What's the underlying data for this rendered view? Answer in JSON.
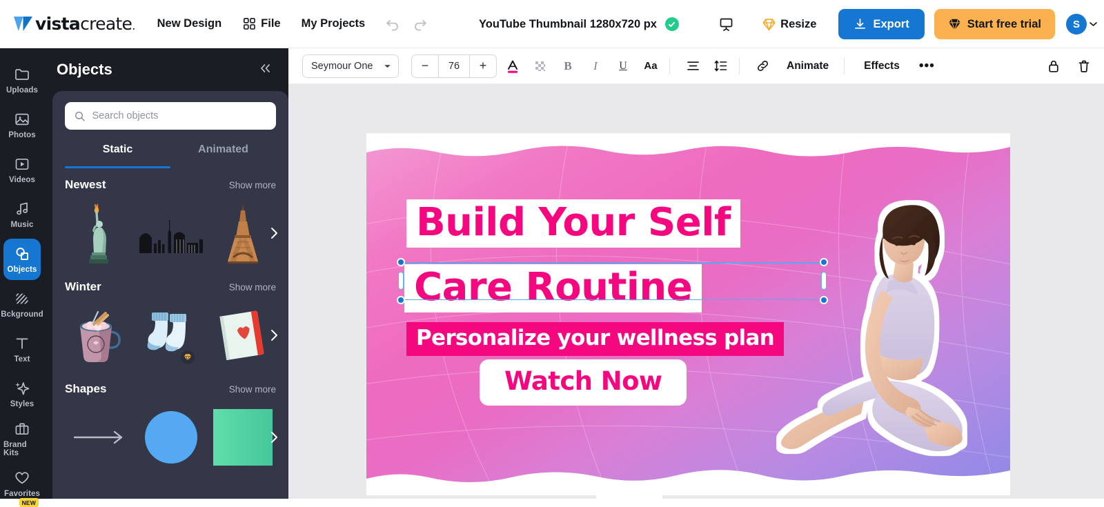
{
  "header": {
    "brand": {
      "bold": "vista",
      "light": "create",
      "dot": "."
    },
    "nav": [
      {
        "label": "New Design",
        "icon": ""
      },
      {
        "label": "File",
        "icon": "grid-icon"
      },
      {
        "label": "My Projects",
        "icon": ""
      }
    ],
    "undo_icon": "undo-arrow-icon",
    "redo_icon": "redo-arrow-icon",
    "doc_title": "YouTube Thumbnail 1280x720 px",
    "saved_icon": "cloud-check-icon",
    "present_icon": "presentation-icon",
    "resize_label": "Resize",
    "export_label": "Export",
    "trial_label": "Start free trial",
    "avatar_initial": "S",
    "accent_blue": "#1577d2",
    "accent_orange": "#fbb150",
    "saved_green": "#23cc8c"
  },
  "rail": {
    "items": [
      {
        "label": "Uploads",
        "icon": "folder-icon",
        "active": false,
        "badge": ""
      },
      {
        "label": "Photos",
        "icon": "image-icon",
        "active": false,
        "badge": ""
      },
      {
        "label": "Videos",
        "icon": "video-icon",
        "active": false,
        "badge": ""
      },
      {
        "label": "Music",
        "icon": "music-note-icon",
        "active": false,
        "badge": ""
      },
      {
        "label": "Objects",
        "icon": "shapes-icon",
        "active": true,
        "badge": ""
      },
      {
        "label": "Bckground",
        "icon": "hatch-pattern-icon",
        "active": false,
        "badge": ""
      },
      {
        "label": "Text",
        "icon": "text-t-icon",
        "active": false,
        "badge": ""
      },
      {
        "label": "Styles",
        "icon": "sparkle-icon",
        "active": false,
        "badge": ""
      },
      {
        "label": "Brand Kits",
        "icon": "briefcase-icon",
        "active": false,
        "badge": ""
      },
      {
        "label": "Favorites",
        "icon": "heart-icon",
        "active": false,
        "badge": "NEW"
      }
    ]
  },
  "panel": {
    "title": "Objects",
    "collapse_icon": "chevron-double-left-icon",
    "search": {
      "placeholder": "Search objects",
      "value": "",
      "icon": "search-icon"
    },
    "tabs": [
      {
        "label": "Static",
        "active": true
      },
      {
        "label": "Animated",
        "active": false
      }
    ],
    "categories": [
      {
        "title": "Newest",
        "more_label": "Show more",
        "items": [
          {
            "name": "statue-of-liberty-thumb",
            "premium": false
          },
          {
            "name": "city-skyline-thumb",
            "premium": false
          },
          {
            "name": "eiffel-tower-thumb",
            "premium": false
          }
        ]
      },
      {
        "title": "Winter",
        "more_label": "Show more",
        "items": [
          {
            "name": "hot-cocoa-mug-thumb",
            "premium": false
          },
          {
            "name": "wool-socks-thumb",
            "premium": true
          },
          {
            "name": "notebook-heart-thumb",
            "premium": false
          }
        ]
      },
      {
        "title": "Shapes",
        "more_label": "Show more",
        "items": [
          {
            "name": "arrow-shape-thumb",
            "premium": false
          },
          {
            "name": "circle-shape-thumb",
            "premium": false
          },
          {
            "name": "square-shape-thumb",
            "premium": false
          }
        ]
      }
    ]
  },
  "toolbar": {
    "font_name": "Seymour One",
    "font_dropdown_icon": "chevron-down-icon",
    "size_decrease": "−",
    "size_value": "76",
    "size_increase": "+",
    "text_color_icon": "text-color-A-icon",
    "text_color": "#f5087f",
    "highlight_icon": "color-picker-checker-icon",
    "bold_label": "B",
    "italic_label": "I",
    "underline_label": "U",
    "case_label": "Aa",
    "align_icon": "text-align-center-icon",
    "line_spacing_icon": "line-spacing-icon",
    "link_icon": "link-chain-icon",
    "animate_label": "Animate",
    "effects_label": "Effects",
    "more_label": "•••",
    "lock_icon": "lock-icon",
    "delete_icon": "trash-icon"
  },
  "design": {
    "headline_1": "Build Your Self",
    "headline_2": "Care Routine",
    "subtitle": "Personalize your wellness plan",
    "cta": "Watch Now",
    "headline_color": "#f5087f",
    "subtitle_bg": "#f5087f",
    "subtitle_color": "#ffffff",
    "cta_color": "#f5087f",
    "cta_bg": "#ffffff",
    "photo_alt": "woman-yoga-pose-photo",
    "selected_layer": "Care Routine"
  }
}
